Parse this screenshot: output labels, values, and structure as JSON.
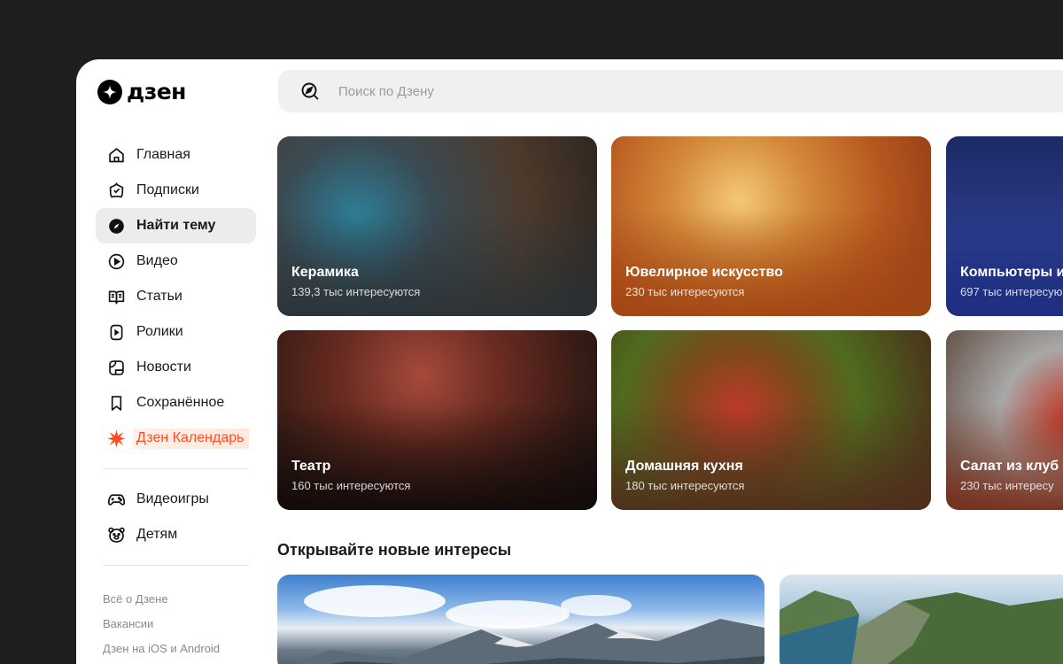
{
  "brand": {
    "name": "дзен"
  },
  "search": {
    "placeholder": "Поиск по Дзену"
  },
  "nav": {
    "items": [
      {
        "label": "Главная",
        "icon": "home-icon"
      },
      {
        "label": "Подписки",
        "icon": "subscriptions-icon"
      },
      {
        "label": "Найти тему",
        "icon": "compass-icon",
        "active": true
      },
      {
        "label": "Видео",
        "icon": "video-icon"
      },
      {
        "label": "Статьи",
        "icon": "book-icon"
      },
      {
        "label": "Ролики",
        "icon": "shorts-icon"
      },
      {
        "label": "Новости",
        "icon": "news-icon"
      },
      {
        "label": "Сохранённое",
        "icon": "bookmark-icon"
      },
      {
        "label": "Дзен Календарь",
        "icon": "burst-icon",
        "accent": "#ff4c1f"
      }
    ],
    "secondary": [
      {
        "label": "Видеоигры",
        "icon": "gamepad-icon"
      },
      {
        "label": "Детям",
        "icon": "bear-icon"
      }
    ]
  },
  "footer_links": [
    "Всё о Дзене",
    "Вакансии",
    "Дзен на iOS и Android"
  ],
  "topics": [
    {
      "title": "Керамика",
      "count": "139,3 тыс интересуются",
      "color": "#3b4a52"
    },
    {
      "title": "Ювелирное искусство",
      "count": "230 тыс интересуются",
      "color": "#a8501c"
    },
    {
      "title": "Компьютеры и",
      "count": "697 тыс интересую",
      "color": "#2c3d8c"
    },
    {
      "title": "Театр",
      "count": "160 тыс интересуются",
      "color": "#2a1a14"
    },
    {
      "title": "Домашняя кухня",
      "count": "180 тыс интересуются",
      "color": "#5a3320"
    },
    {
      "title": "Салат из клуб",
      "count": "230 тыс интересу",
      "color": "#7a2c18"
    }
  ],
  "discover": {
    "title": "Открывайте новые интересы"
  }
}
